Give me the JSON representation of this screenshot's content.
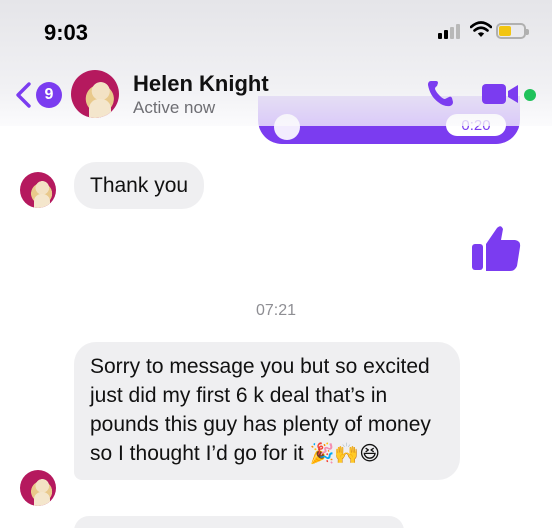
{
  "status_bar": {
    "time": "9:03"
  },
  "header": {
    "unread_count": "9",
    "contact_name": "Helen Knight",
    "contact_status": "Active now"
  },
  "voice_message": {
    "duration": "0:20"
  },
  "messages": [
    {
      "text": "Thank you"
    },
    {
      "text": "Sorry to message you but so excited just did my first 6 k deal that’s in pounds this guy has plenty of money so I thought I’d go for it",
      "emojis": "🎉🙌😆"
    }
  ],
  "timestamp": "07:21",
  "colors": {
    "accent": "#7b3cf0",
    "online": "#1fc25a",
    "bubble": "#efeff1"
  },
  "icons": [
    "back-chevron-icon",
    "phone-icon",
    "video-camera-icon",
    "thumbs-up-icon",
    "wifi-icon",
    "battery-icon",
    "cellular-signal-icon"
  ]
}
